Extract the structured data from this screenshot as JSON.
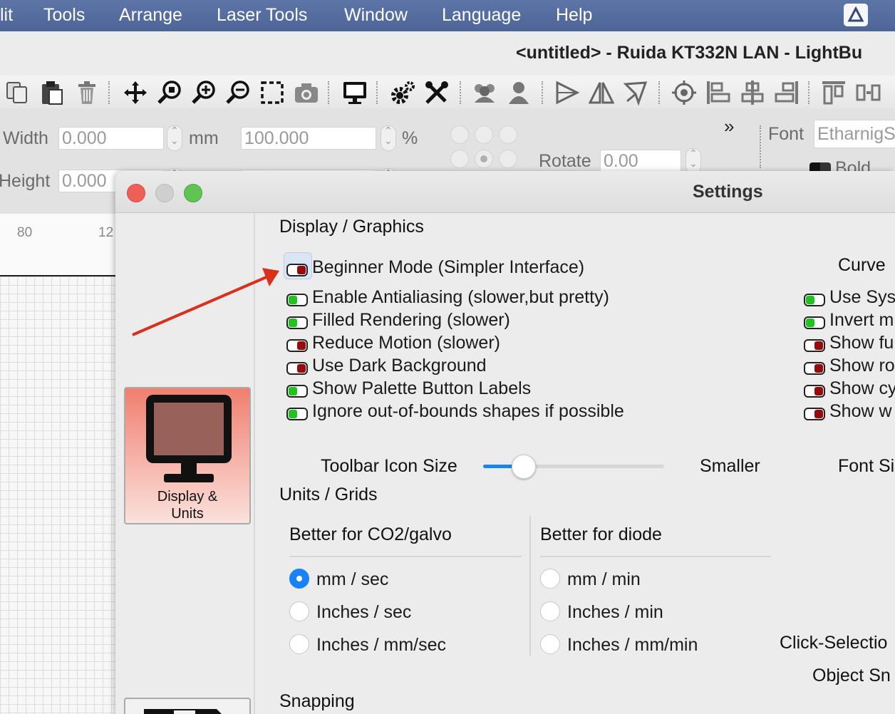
{
  "menubar": {
    "items": [
      "lit",
      "Tools",
      "Arrange",
      "Laser Tools",
      "Window",
      "Language",
      "Help"
    ]
  },
  "titlebar": {
    "title": "<untitled> - Ruida KT332N LAN - LightBu"
  },
  "toolbar": {
    "icons": [
      "copy-icon",
      "paste-icon",
      "delete-icon",
      "move-icon",
      "zoom-selection-icon",
      "zoom-in-icon",
      "zoom-out-icon",
      "zoom-frame-icon",
      "camera-icon",
      "monitor-icon",
      "settings-gears-icon",
      "tools-icon",
      "group-icon",
      "ungroup-icon",
      "mirror-horizontal-icon",
      "mirror-vertical-icon",
      "rotate-arrow-icon",
      "target-icon",
      "align-left-icon",
      "align-center-icon",
      "align-right-icon",
      "align-top-icon",
      "distribute-icon"
    ]
  },
  "props": {
    "width_label": "Width",
    "width_value": "0.000",
    "height_label": "Height",
    "height_value": "0.000",
    "unit_mm": "mm",
    "scale_value": "100.000",
    "unit_percent": "%",
    "rotate_label": "Rotate",
    "rotate_value": "0.00",
    "font_label": "Font",
    "font_value": "EtharnigS",
    "bold_label": "Bold"
  },
  "ruler": {
    "labels": [
      "80",
      "12"
    ]
  },
  "settings": {
    "title": "Settings",
    "category_display": "Display &\nUnits",
    "display_graphics_title": "Display / Graphics",
    "options_left": [
      {
        "label": "Beginner Mode (Simpler Interface)",
        "on": false
      },
      {
        "label": "Enable Antialiasing (slower,but pretty)",
        "on": true
      },
      {
        "label": "Filled Rendering (slower)",
        "on": true
      },
      {
        "label": "Reduce Motion (slower)",
        "on": false
      },
      {
        "label": "Use Dark Background",
        "on": false
      },
      {
        "label": "Show Palette Button Labels",
        "on": true
      },
      {
        "label": "Ignore out-of-bounds shapes if possible",
        "on": true
      }
    ],
    "curve_title": "Curve",
    "options_right": [
      {
        "label": "Use Sys",
        "on": true
      },
      {
        "label": "Invert m",
        "on": true
      },
      {
        "label": "Show fu",
        "on": false
      },
      {
        "label": "Show ro",
        "on": false
      },
      {
        "label": "Show cy",
        "on": false
      },
      {
        "label": "Show w",
        "on": false
      }
    ],
    "toolbar_icon_size_label": "Toolbar Icon Size",
    "toolbar_icon_size_value": 0.22,
    "smaller_label": "Smaller",
    "font_size_label": "Font Si",
    "units_grids_title": "Units / Grids",
    "co2_title": "Better for CO2/galvo",
    "diode_title": "Better for diode",
    "co2_options": [
      {
        "label": "mm / sec",
        "selected": true
      },
      {
        "label": "Inches / sec",
        "selected": false
      },
      {
        "label": "Inches / mm/sec",
        "selected": false
      }
    ],
    "diode_options": [
      {
        "label": "mm / min",
        "selected": false
      },
      {
        "label": "Inches / min",
        "selected": false
      },
      {
        "label": "Inches / mm/min",
        "selected": false
      }
    ],
    "click_selection_label": "Click-Selectio",
    "object_snap_label": "Object Sn",
    "snapping_title": "Snapping"
  },
  "colors": {
    "menubar": "#5269a0",
    "toggle_on": "#1fc41f",
    "toggle_off": "#9b0a0a",
    "radio_selected": "#1a82f8",
    "annotation_arrow": "#d9301c",
    "category_active": "#f07f6f"
  }
}
